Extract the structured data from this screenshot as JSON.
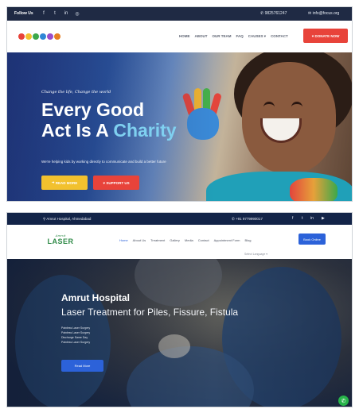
{
  "screenshot1": {
    "topbar": {
      "follow_label": "Follow Us",
      "social_icons": [
        "facebook-icon",
        "twitter-icon",
        "linkedin-icon",
        "instagram-icon"
      ],
      "social_glyphs": [
        "f",
        "t",
        "in",
        "◎"
      ],
      "phone": "9825761247",
      "email": "info@focus.org"
    },
    "nav": {
      "menu": [
        "HOME",
        "ABOUT",
        "OUR TEAM",
        "FAQ",
        "CAUSES",
        "CONTACT"
      ],
      "donate_label": "DONATE NOW"
    },
    "hero": {
      "tagline": "Change the life, Change the world",
      "title_line1": "Every Good",
      "title_line2_a": "Act Is A ",
      "title_line2_b": "Charity",
      "subtitle": "We're helping kids by working directly to communicate and build a better future",
      "read_more_label": "READ MORE",
      "support_label": "SUPPORT US"
    },
    "colors": {
      "accent": "#e8433a",
      "topbar": "#1f2a44",
      "yellow": "#f2c12e"
    }
  },
  "screenshot2": {
    "topbar": {
      "address": "Amrut Hospital, Ahmedabad",
      "phone": "+91 9779990017",
      "social_icons": [
        "facebook-icon",
        "twitter-icon",
        "linkedin-icon",
        "youtube-icon"
      ],
      "social_glyphs": [
        "f",
        "t",
        "in",
        "▶"
      ]
    },
    "nav": {
      "logo_small": "Amrut",
      "logo_big": "LASER",
      "menu": [
        "Home",
        "About Us",
        "Treatment",
        "Gallery",
        "Media",
        "Contact",
        "Appointment Form",
        "Blog"
      ],
      "book_label": "Book Online",
      "language": "Select Language ▾"
    },
    "hero": {
      "title": "Amrut Hospital",
      "subtitle": "Laser Treatment for Piles, Fissure, Fistula",
      "points": [
        "Painless Laser Surgery",
        "Painless Laser Surgery",
        "Discharge Same Day",
        "Painless Laser Surgery"
      ],
      "read_more_label": "Read More"
    },
    "colors": {
      "accent": "#2c62d9",
      "topbar": "#132448",
      "whatsapp": "#28b44a"
    }
  }
}
